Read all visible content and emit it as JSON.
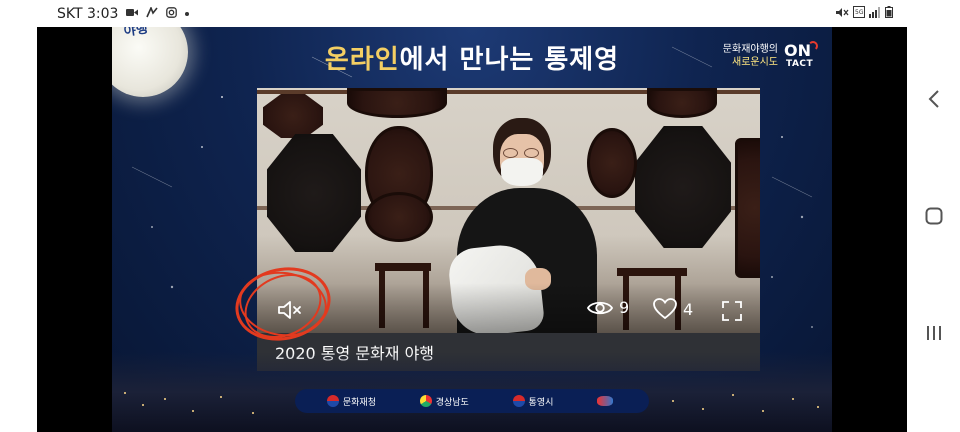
{
  "status_bar": {
    "carrier_time": "SKT 3:03",
    "left_icons": [
      "video-call-icon",
      "nfc-icon",
      "instagram-icon",
      "notification-dot-icon"
    ],
    "right_icons": [
      "mute-icon",
      "5g-icon",
      "signal-icon",
      "battery-icon"
    ]
  },
  "banner": {
    "moon_logo_text": "통영 문화재 야행",
    "title_part1": "온라인",
    "title_part2": "에서 만나는 통제영",
    "ontact_line1": "문화재야행의",
    "ontact_line2": "새로운시도",
    "ontact_logo_on": "ON",
    "ontact_logo_tact": "TACT"
  },
  "video": {
    "mute_state": "muted",
    "view_count": "9",
    "like_count": "4",
    "caption": "2020 통영 문화재 야행"
  },
  "sponsors": [
    {
      "name": "문화재청",
      "icon": "taeguk-icon"
    },
    {
      "name": "경상남도",
      "icon": "gyeongnam-icon"
    },
    {
      "name": "통영시",
      "icon": "tongyeong-icon"
    },
    {
      "name": "",
      "icon": "heritage-foundation-icon"
    }
  ],
  "colors": {
    "accent_gold": "#f4cf63",
    "annotation_red": "#e23a1f",
    "caption_bg": "#2f3136",
    "banner_blue": "#0f2450"
  }
}
